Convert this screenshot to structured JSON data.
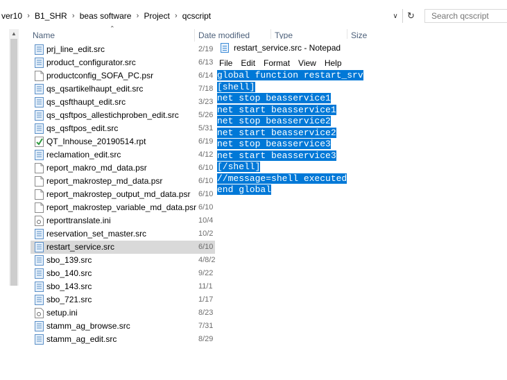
{
  "address": {
    "crumbs": [
      "ver10",
      "B1_SHR",
      "beas software",
      "Project",
      "qcscript"
    ],
    "search_placeholder": "Search qcscript",
    "refresh_icon": "refresh-icon",
    "dropdown_icon": "chevron-down-icon"
  },
  "columns": {
    "name": "Name",
    "date": "Date modified",
    "type": "Type",
    "size": "Size"
  },
  "files": [
    {
      "name": "prj_line_edit.src",
      "date": "2/19",
      "icon": "src-file-icon"
    },
    {
      "name": "product_configurator.src",
      "date": "6/13",
      "icon": "src-file-icon"
    },
    {
      "name": "productconfig_SOFA_PC.psr",
      "date": "6/14",
      "icon": "generic-file-icon"
    },
    {
      "name": "qs_qsartikelhaupt_edit.src",
      "date": "7/18",
      "icon": "src-file-icon"
    },
    {
      "name": "qs_qsfthaupt_edit.src",
      "date": "3/23",
      "icon": "src-file-icon"
    },
    {
      "name": "qs_qsftpos_allestichproben_edit.src",
      "date": "5/26",
      "icon": "src-file-icon"
    },
    {
      "name": "qs_qsftpos_edit.src",
      "date": "5/31",
      "icon": "src-file-icon"
    },
    {
      "name": "QT_Inhouse_20190514.rpt",
      "date": "6/19",
      "icon": "report-file-icon"
    },
    {
      "name": "reclamation_edit.src",
      "date": "4/12",
      "icon": "src-file-icon"
    },
    {
      "name": "report_makro_md_data.psr",
      "date": "6/10",
      "icon": "generic-file-icon"
    },
    {
      "name": "report_makrostep_md_data.psr",
      "date": "6/10",
      "icon": "generic-file-icon"
    },
    {
      "name": "report_makrostep_output_md_data.psr",
      "date": "6/10",
      "icon": "generic-file-icon"
    },
    {
      "name": "report_makrostep_variable_md_data.psr",
      "date": "6/10",
      "icon": "generic-file-icon"
    },
    {
      "name": "reporttranslate.ini",
      "date": "10/4",
      "icon": "settings-file-icon"
    },
    {
      "name": "reservation_set_master.src",
      "date": "10/2",
      "icon": "src-file-icon"
    },
    {
      "name": "restart_service.src",
      "date": "6/10",
      "icon": "src-file-icon",
      "selected": true
    },
    {
      "name": "sbo_139.src",
      "date": "4/8/2",
      "icon": "src-file-icon"
    },
    {
      "name": "sbo_140.src",
      "date": "9/22",
      "icon": "src-file-icon"
    },
    {
      "name": "sbo_143.src",
      "date": "11/1",
      "icon": "src-file-icon"
    },
    {
      "name": "sbo_721.src",
      "date": "1/17",
      "icon": "src-file-icon"
    },
    {
      "name": "setup.ini",
      "date": "8/23",
      "icon": "settings-file-icon"
    },
    {
      "name": "stamm_ag_browse.src",
      "date": "7/31",
      "icon": "src-file-icon"
    },
    {
      "name": "stamm_ag_edit.src",
      "date": "8/29",
      "icon": "src-file-icon"
    }
  ],
  "notepad": {
    "title": "restart_service.src - Notepad",
    "menu": [
      "File",
      "Edit",
      "Format",
      "View",
      "Help"
    ],
    "lines": [
      "global function restart_srv",
      "[shell]",
      "net stop beasservice1",
      "net start beasservice1",
      "net stop beasservice2",
      "net start beasservice2",
      "net stop beasservice3",
      "net start beasservice3",
      "[/shell]",
      "//message=shell executed",
      "end global"
    ],
    "selection_color": "#0078d7"
  }
}
